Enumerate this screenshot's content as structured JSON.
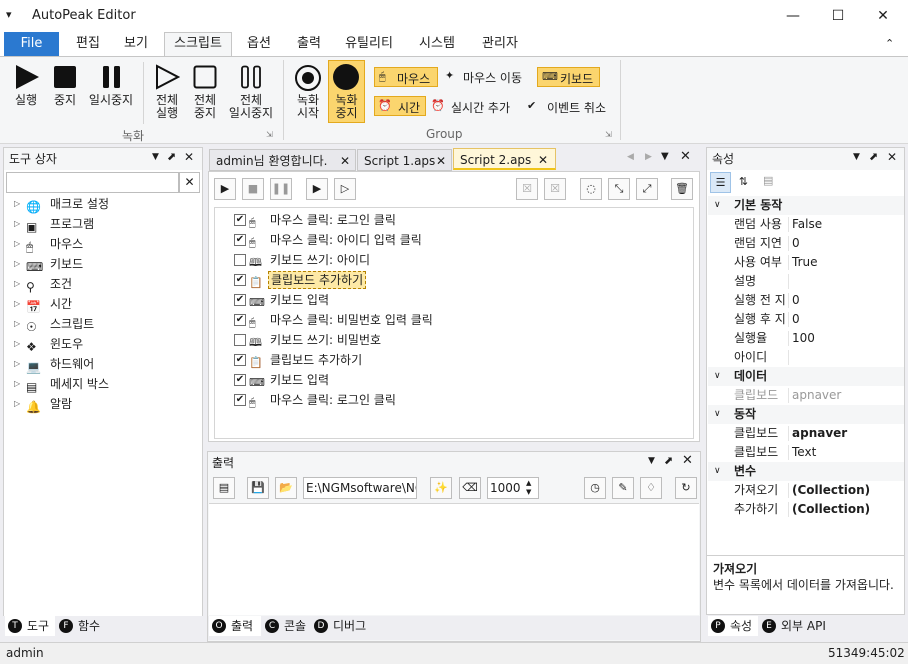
{
  "window": {
    "title": "AutoPeak Editor"
  },
  "menu": [
    "File",
    "편집",
    "보기",
    "스크립트",
    "옵션",
    "출력",
    "유틸리티",
    "시스템",
    "관리자"
  ],
  "ribbon": {
    "record_group": {
      "label": "녹화",
      "buttons": [
        {
          "label1": "실행",
          "label2": ""
        },
        {
          "label1": "중지",
          "label2": ""
        },
        {
          "label1": "일시중지",
          "label2": ""
        },
        {
          "label1": "전체",
          "label2": "실행"
        },
        {
          "label1": "전체",
          "label2": "중지"
        },
        {
          "label1": "전체",
          "label2": "일시중지"
        }
      ]
    },
    "group_group": {
      "label": "Group",
      "rec_start": {
        "label1": "녹화",
        "label2": "시작"
      },
      "rec_stop": {
        "label1": "녹화",
        "label2": "중지"
      },
      "toggles": [
        "마우스",
        "마우스 이동",
        "키보드",
        "시간",
        "실시간 추가",
        "이벤트 취소"
      ]
    }
  },
  "toolbox": {
    "title": "도구 상자",
    "items": [
      "매크로 설정",
      "프로그램",
      "마우스",
      "키보드",
      "조건",
      "시간",
      "스크립트",
      "윈도우",
      "하드웨어",
      "메세지 박스",
      "알람"
    ],
    "bottom_tabs": [
      "도구",
      "함수"
    ]
  },
  "editor": {
    "tabs": [
      "admin님 환영합니다.",
      "Script 1.aps",
      "Script 2.aps"
    ],
    "steps": [
      {
        "text": "마우스 클릭: 로그인 클릭",
        "checked": true,
        "icon": "mouse"
      },
      {
        "text": "마우스 클릭: 아이디 입력 클릭",
        "checked": true,
        "icon": "mouse"
      },
      {
        "text": "키보드 쓰기: 아이디",
        "checked": false,
        "icon": "book"
      },
      {
        "text": "클립보드 추가하기",
        "checked": true,
        "icon": "clipboard"
      },
      {
        "text": "키보드 입력",
        "checked": true,
        "icon": "keyboard"
      },
      {
        "text": "마우스 클릭: 비밀번호 입력 클릭",
        "checked": true,
        "icon": "mouse"
      },
      {
        "text": "키보드 쓰기: 비밀번호",
        "checked": false,
        "icon": "book"
      },
      {
        "text": "클립보드 추가하기",
        "checked": true,
        "icon": "clipboard"
      },
      {
        "text": "키보드 입력",
        "checked": true,
        "icon": "keyboard"
      },
      {
        "text": "마우스 클릭: 로그인 클릭",
        "checked": true,
        "icon": "mouse"
      }
    ],
    "selected_index": 3
  },
  "output": {
    "title": "출력",
    "path": "E:\\NGMsoftware\\NG",
    "number": "1000",
    "bottom_tabs": [
      "출력",
      "콘솔",
      "디버그"
    ]
  },
  "properties": {
    "title": "속성",
    "categories": [
      {
        "name": "기본 동작",
        "rows": [
          {
            "name": "랜덤 사용",
            "value": "False"
          },
          {
            "name": "랜덤 지연",
            "value": "0"
          },
          {
            "name": "사용 여부",
            "value": "True"
          },
          {
            "name": "설명",
            "value": ""
          },
          {
            "name": "실행 전 지",
            "value": "0"
          },
          {
            "name": "실행 후 지",
            "value": "0"
          },
          {
            "name": "실행율",
            "value": "100"
          },
          {
            "name": "아이디",
            "value": ""
          }
        ]
      },
      {
        "name": "데이터",
        "rows": [
          {
            "name": "클립보드",
            "value": "apnaver",
            "muted": true
          }
        ]
      },
      {
        "name": "동작",
        "rows": [
          {
            "name": "클립보드",
            "value": "apnaver",
            "bold": true
          },
          {
            "name": "클립보드",
            "value": "Text"
          }
        ]
      },
      {
        "name": "변수",
        "rows": [
          {
            "name": "가져오기",
            "value": "(Collection)",
            "bold": true
          },
          {
            "name": "추가하기",
            "value": "(Collection)",
            "bold": true
          }
        ]
      }
    ],
    "desc_title": "가져오기",
    "desc_text": "변수 목록에서 데이터를 가져옵니다.",
    "bottom_tabs": [
      "속성",
      "외부 API"
    ]
  },
  "status": {
    "user": "admin",
    "time": "51349:45:02"
  }
}
